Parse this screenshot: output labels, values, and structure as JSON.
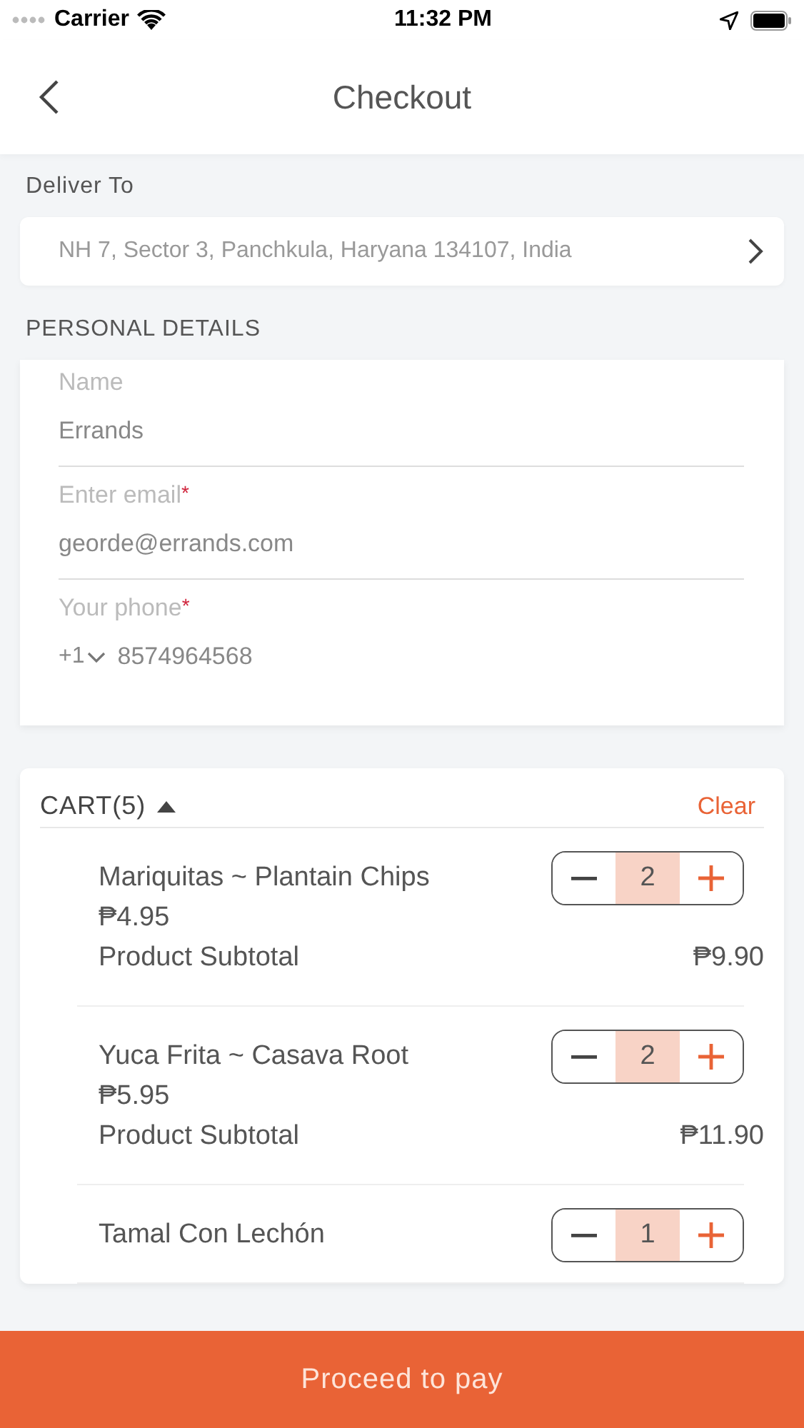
{
  "status_bar": {
    "carrier": "Carrier",
    "time": "11:32 PM"
  },
  "nav": {
    "title": "Checkout"
  },
  "delivery": {
    "label": "Deliver To",
    "address": "NH 7, Sector 3, Panchkula, Haryana 134107, India"
  },
  "personal_details": {
    "heading": "PERSONAL DETAILS",
    "fields": [
      {
        "kind": "text",
        "label": "Name",
        "value": "Errands"
      },
      {
        "kind": "text",
        "label": "Enter email",
        "required_mark": "*",
        "value": "georde@errands.com"
      },
      {
        "kind": "phone",
        "label": "Your phone",
        "required_mark": "*",
        "country_code": "+1",
        "value": "8574964568"
      }
    ]
  },
  "cart": {
    "title": "CART(5)",
    "expanded": true,
    "clear": "Clear",
    "items": [
      {
        "name": "Mariquitas ~ Plantain Chips",
        "price": "₱4.95",
        "subtotal_label": "Product Subtotal",
        "subtotal": "₱9.90",
        "quantity": "2"
      },
      {
        "name": "Yuca Frita ~ Casava Root",
        "price": "₱5.95",
        "subtotal_label": "Product Subtotal",
        "subtotal": "₱11.90",
        "quantity": "2"
      },
      {
        "name": "Tamal Con Lechón",
        "quantity": "1"
      }
    ]
  },
  "pay_button": "Proceed to pay"
}
